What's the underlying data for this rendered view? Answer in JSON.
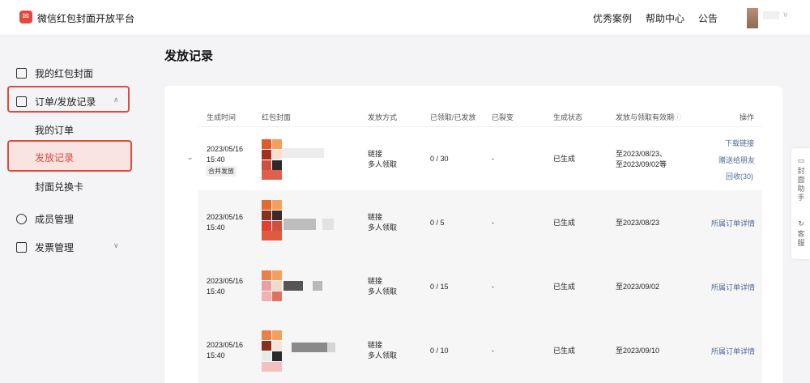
{
  "header": {
    "app_title": "微信红包封面开放平台",
    "nav": [
      "优秀案例",
      "帮助中心",
      "公告"
    ]
  },
  "sidebar": {
    "items": [
      {
        "label": "我的红包封面"
      },
      {
        "label": "订单/发放记录"
      },
      {
        "label": "成员管理"
      },
      {
        "label": "发票管理"
      }
    ],
    "sub_items": [
      {
        "label": "我的订单"
      },
      {
        "label": "发放记录"
      },
      {
        "label": "封面兑换卡"
      }
    ]
  },
  "page": {
    "title": "发放记录"
  },
  "table": {
    "headers": [
      "生成时间",
      "红包封面",
      "发放方式",
      "已领取/已发放",
      "已裂变",
      "生成状态",
      "发放与领取有效期",
      "操作"
    ],
    "rows": [
      {
        "time_date": "2023/05/16",
        "time_clock": "15:40",
        "badge": "合并发放",
        "method_1": "链接",
        "method_2": "多人领取",
        "count": "0 / 30",
        "fission": "-",
        "status": "已生成",
        "validity_1": "至2023/08/23、",
        "validity_2": "至2023/09/02等",
        "actions": [
          "下载链接",
          "赠送给朋友",
          "回收(30)"
        ]
      },
      {
        "time_date": "2023/05/16",
        "time_clock": "15:40",
        "method_1": "链接",
        "method_2": "多人领取",
        "count": "0 / 5",
        "fission": "-",
        "status": "已生成",
        "validity_1": "至2023/08/23",
        "actions": [
          "所属订单详情"
        ]
      },
      {
        "time_date": "2023/05/16",
        "time_clock": "15:40",
        "method_1": "链接",
        "method_2": "多人领取",
        "count": "0 / 15",
        "fission": "-",
        "status": "已生成",
        "validity_1": "至2023/09/02",
        "actions": [
          "所属订单详情"
        ]
      },
      {
        "time_date": "2023/05/16",
        "time_clock": "15:40",
        "method_1": "链接",
        "method_2": "多人领取",
        "count": "0 / 10",
        "fission": "-",
        "status": "已生成",
        "validity_1": "至2023/09/10",
        "actions": [
          "所属订单详情"
        ]
      }
    ]
  },
  "helper": {
    "assistant": "封面助手",
    "service": "客服"
  },
  "colors": {
    "highlight": "#e04a3d",
    "link": "#4a6b9a",
    "brand": "#e5473c"
  }
}
